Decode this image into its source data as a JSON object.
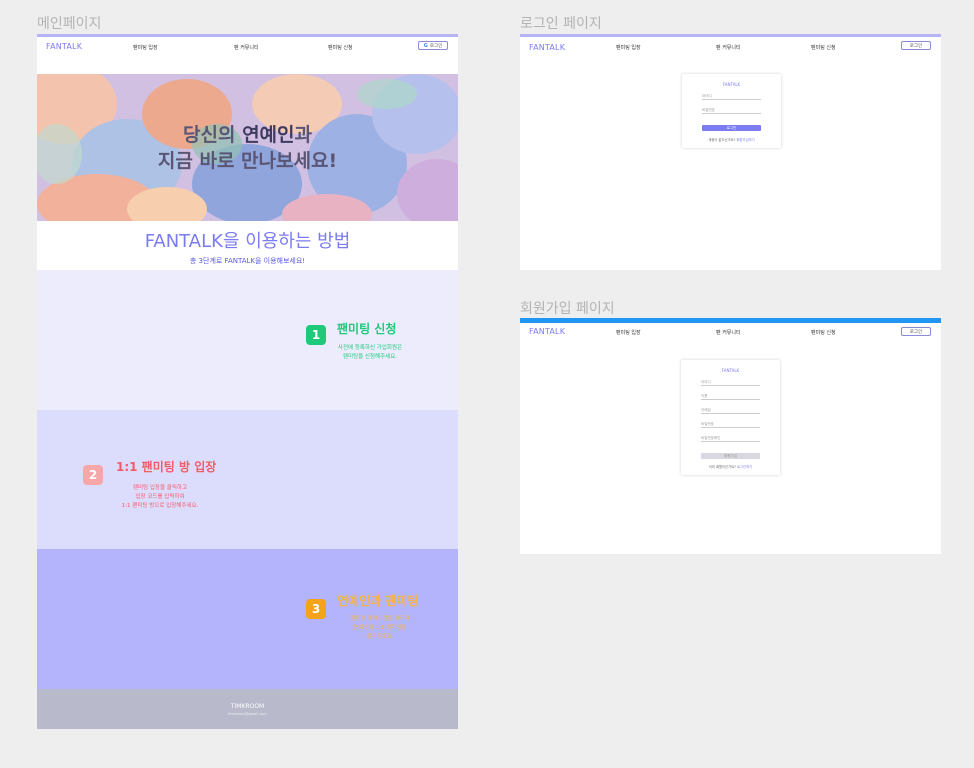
{
  "frames": {
    "main_label": "메인페이지",
    "login_label": "로그인 페이지",
    "signup_label": "회원가입 페이지"
  },
  "nav": {
    "logo": "FANTALK",
    "items": [
      "팬미팅 입장",
      "팬 커뮤니티",
      "팬미팅 신청"
    ],
    "login_button": "로그인",
    "google_letter": "G"
  },
  "hero": {
    "line1_pre": "당신의 ",
    "line1_highlight": "연예인",
    "line1_post": "과",
    "line2": "지금 바로 만나보세요!"
  },
  "how": {
    "title": "FANTALK을 이용하는 방법",
    "subtitle": "총 3단계로 FANTALK을 이용해보세요!"
  },
  "steps": [
    {
      "number": "1",
      "title": "팬미팅 신청",
      "desc": "사전에 등록하신 가입회원은\n팬미팅을 신청해주세요.",
      "color": "#1ec97a"
    },
    {
      "number": "2",
      "title": "1:1 팬미팅 방 입장",
      "desc": "팬미팅 입장을 클릭하고\n입장 코드를 입력하여\n1:1 팬미팅 방으로 입장해주세요.",
      "color": "#f45b69"
    },
    {
      "number": "3",
      "title": "연예인과 팬미팅",
      "desc": "팬미팅 예약시간을 지키며\n연예인과 1:1 팬미팅을\n즐겨주세요.",
      "color": "#f5a31a"
    }
  ],
  "footer": {
    "brand": "TIMKROOM",
    "sub": "timkroom@gmail.com"
  },
  "login_card": {
    "title": "FANTALK",
    "fields": [
      "아이디",
      "비밀번호"
    ],
    "button": "로그인",
    "foot_text": "계정이 없으신가요?",
    "foot_link": "회원가입하기"
  },
  "signup_card": {
    "title": "FANTALK",
    "fields": [
      "아이디",
      "이름",
      "이메일",
      "비밀번호",
      "비밀번호확인"
    ],
    "button": "회원가입",
    "foot_text": "이미 회원이신가요?",
    "foot_link": "로그인하기"
  },
  "colors": {
    "accent": "#7b7bf2",
    "step1_bg": "#ececfd",
    "step2_bg": "#dcdcfc",
    "step3_bg": "#b4b4fc",
    "signup_bar": "#2196f3"
  }
}
